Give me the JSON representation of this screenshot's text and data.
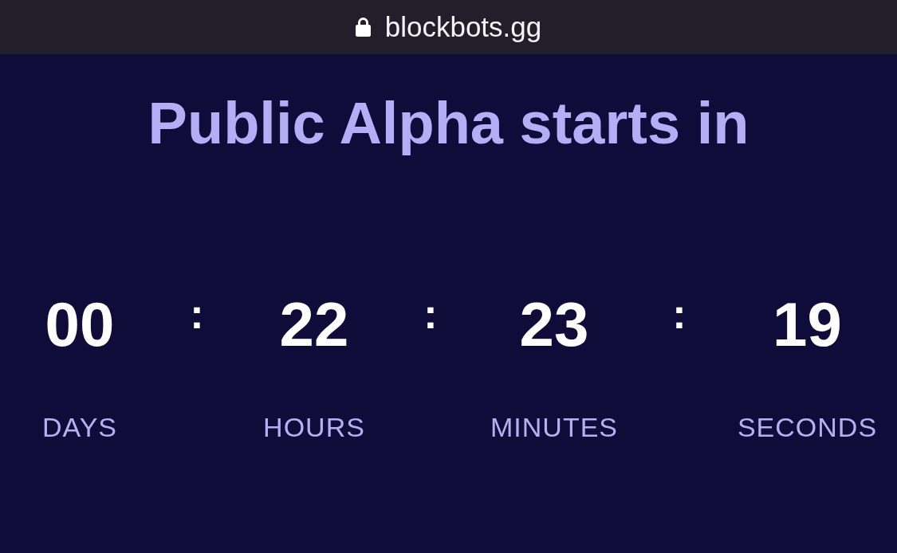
{
  "address_bar": {
    "secure": true,
    "url": "blockbots.gg"
  },
  "heading": "Public Alpha starts in",
  "countdown": {
    "units": [
      {
        "value": "00",
        "label": "DAYS"
      },
      {
        "value": "22",
        "label": "HOURS"
      },
      {
        "value": "23",
        "label": "MINUTES"
      },
      {
        "value": "19",
        "label": "SECONDS"
      }
    ],
    "separators": [
      ":",
      ":",
      ":"
    ]
  }
}
